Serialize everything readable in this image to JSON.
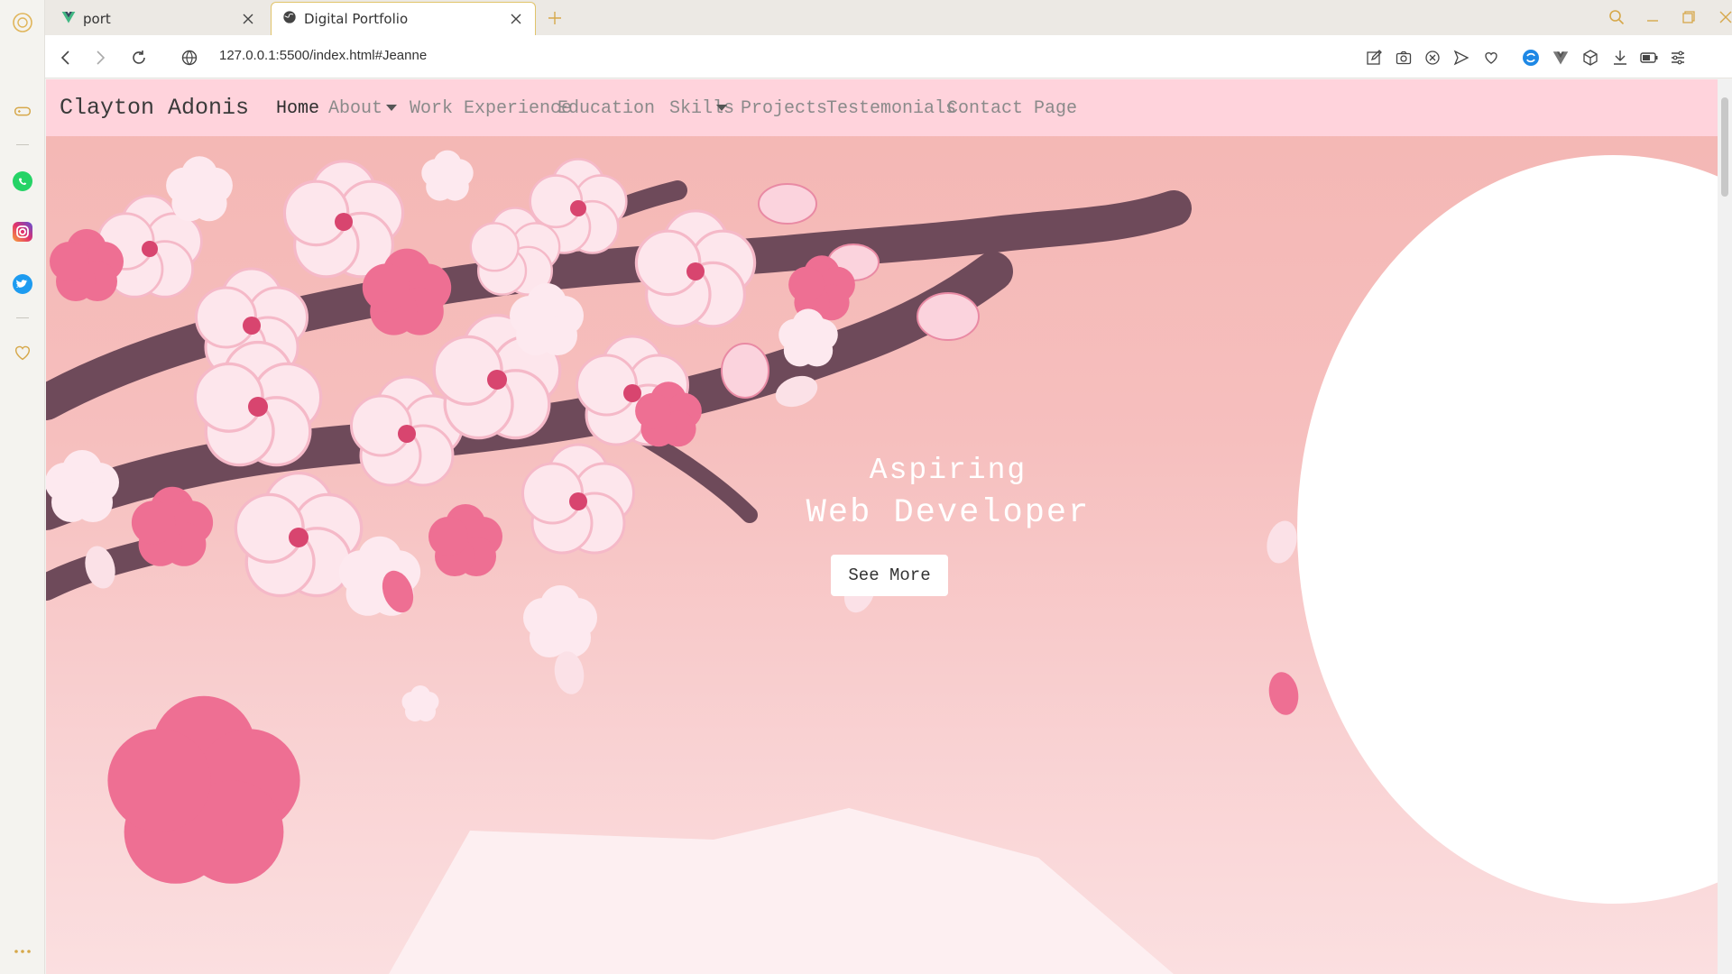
{
  "browser": {
    "tabs": [
      {
        "label": "port",
        "favicon": "vue-icon",
        "active": false
      },
      {
        "label": "Digital Portfolio",
        "favicon": "globe-icon",
        "active": true
      }
    ],
    "url": "127.0.0.1:5500/index.html#Jeanne",
    "colors": {
      "accent": "#e0c46a",
      "chrome": "#ece9e4"
    }
  },
  "site": {
    "brand": "Clayton Adonis",
    "nav": [
      {
        "label": "Home",
        "current": true,
        "dropdown": false
      },
      {
        "label": "About",
        "current": false,
        "dropdown": true
      },
      {
        "label": "Work Experience",
        "current": false,
        "dropdown": false
      },
      {
        "label": "Education",
        "current": false,
        "dropdown": false
      },
      {
        "label": "Skills",
        "current": false,
        "dropdown": true
      },
      {
        "label": "Projects",
        "current": false,
        "dropdown": false
      },
      {
        "label": "Testemonials",
        "current": false,
        "dropdown": false
      },
      {
        "label": "Contact Page",
        "current": false,
        "dropdown": false
      }
    ],
    "hero": {
      "line1": "Aspiring",
      "line2": "Web Developer",
      "button": "See More"
    },
    "colors": {
      "nav_bg": "#ffd3dc",
      "hero_bg": "#f6bfbe",
      "blossom": "#ee6f93",
      "branch": "#6e4a5a"
    }
  }
}
